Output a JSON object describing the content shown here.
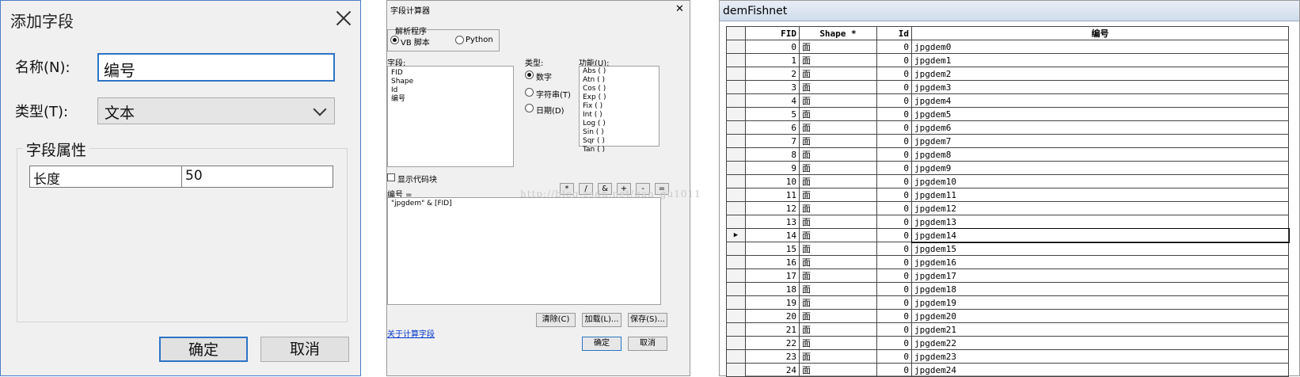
{
  "add_field": {
    "title": "添加字段",
    "name_label": "名称(N):",
    "name_value": "编号",
    "type_label": "类型(T):",
    "type_value": "文本",
    "group_title": "字段属性",
    "prop_key": "长度",
    "prop_value": "50",
    "ok_label": "确定",
    "cancel_label": "取消"
  },
  "field_calculator": {
    "title": "字段计算器",
    "parser_label": "解析程序",
    "parser_vb": "VB 脚本",
    "parser_python": "Python",
    "fields_label": "字段:",
    "fields": [
      "FID",
      "Shape",
      "Id",
      "编号"
    ],
    "type_label": "类型:",
    "type_number": "数字",
    "type_string": "字符串(T)",
    "type_date": "日期(D)",
    "functions_label": "功能(U):",
    "functions": [
      "Abs ( )",
      "Atn ( )",
      "Cos ( )",
      "Exp ( )",
      "Fix ( )",
      "Int ( )",
      "Log ( )",
      "Sin ( )",
      "Sqr ( )",
      "Tan ( )"
    ],
    "show_codeblock": "显示代码块",
    "ops": [
      "*",
      "/",
      "&",
      "+",
      "-",
      "="
    ],
    "expr_label": "编号 =",
    "expression": "\"jpgdem\" & [FID]",
    "about_link": "关于计算字段",
    "clear_btn": "清除(C)",
    "load_btn": "加载(L)...",
    "save_btn": "保存(S)...",
    "ok_btn": "确定",
    "cancel_btn": "取消",
    "watermark": "http://blog.csdn.net/gan_gu1011"
  },
  "table": {
    "title": "demFishnet",
    "headers": [
      "FID",
      "Shape *",
      "Id",
      "编号"
    ],
    "shape_symbol": "面",
    "current_row": 14,
    "rows": [
      [
        0,
        "0",
        "jpgdem0"
      ],
      [
        1,
        "0",
        "jpgdem1"
      ],
      [
        2,
        "0",
        "jpgdem2"
      ],
      [
        3,
        "0",
        "jpgdem3"
      ],
      [
        4,
        "0",
        "jpgdem4"
      ],
      [
        5,
        "0",
        "jpgdem5"
      ],
      [
        6,
        "0",
        "jpgdem6"
      ],
      [
        7,
        "0",
        "jpgdem7"
      ],
      [
        8,
        "0",
        "jpgdem8"
      ],
      [
        9,
        "0",
        "jpgdem9"
      ],
      [
        10,
        "0",
        "jpgdem10"
      ],
      [
        11,
        "0",
        "jpgdem11"
      ],
      [
        12,
        "0",
        "jpgdem12"
      ],
      [
        13,
        "0",
        "jpgdem13"
      ],
      [
        14,
        "0",
        "jpgdem14"
      ],
      [
        15,
        "0",
        "jpgdem15"
      ],
      [
        16,
        "0",
        "jpgdem16"
      ],
      [
        17,
        "0",
        "jpgdem17"
      ],
      [
        18,
        "0",
        "jpgdem18"
      ],
      [
        19,
        "0",
        "jpgdem19"
      ],
      [
        20,
        "0",
        "jpgdem20"
      ],
      [
        21,
        "0",
        "jpgdem21"
      ],
      [
        22,
        "0",
        "jpgdem22"
      ],
      [
        23,
        "0",
        "jpgdem23"
      ],
      [
        24,
        "0",
        "jpgdem24"
      ]
    ]
  }
}
